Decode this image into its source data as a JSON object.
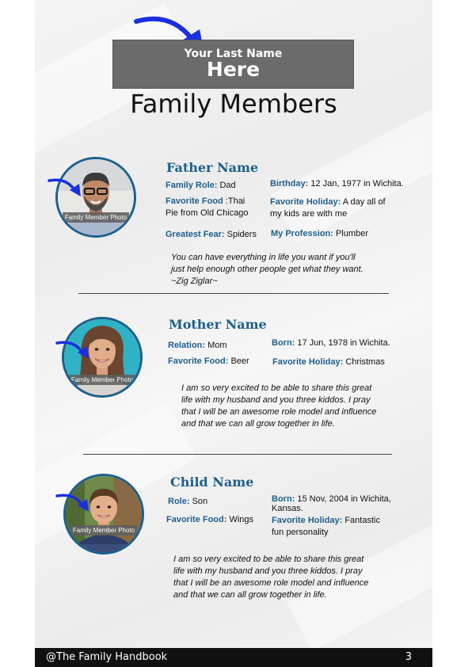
{
  "header": {
    "banner_line1": "Your Last Name",
    "banner_line2": "Here",
    "title": "Family Members"
  },
  "colors": {
    "accent": "#1d5f8c",
    "banner": "#6b6b6b",
    "arrow": "#1a2fe0",
    "footer": "#111111"
  },
  "members": [
    {
      "name": "Father Name",
      "photo_label": "Family Member Photo",
      "fields": [
        {
          "label": "Family Role:",
          "value": "Dad"
        },
        {
          "label": "Birthday:",
          "value": "12 Jan, 1977 in Wichita."
        },
        {
          "label": "Favorite Food",
          "value": ":Thai",
          "extra": "Pie from Old Chicago"
        },
        {
          "label": "Favorite Holiday:",
          "value": "A day all of",
          "extra": "my kids are with me"
        },
        {
          "label": "Greatest Fear:",
          "value": "Spiders"
        },
        {
          "label": "My Profession:",
          "value": "Plumber"
        }
      ],
      "quote": [
        "You can have everything in life you want if you'll",
        "just help enough other people get what they want.",
        "~Zig Ziglar~"
      ]
    },
    {
      "name": "Mother Name",
      "photo_label": "Family Member Photo",
      "fields": [
        {
          "label": "Relation:",
          "value": "Mom"
        },
        {
          "label": "Born:",
          "value": "17 Jun, 1978 in Wichita."
        },
        {
          "label": "Favorite Food:",
          "value": "Beer"
        },
        {
          "label": "Favorite Holiday:",
          "value": "Christmas"
        }
      ],
      "quote": [
        "I am so very excited to be able to share this great",
        "life with my husband and you three kiddos. I pray",
        "that I will be an awesome role model and influence",
        "and that we can all grow together in life."
      ]
    },
    {
      "name": "Child Name",
      "photo_label": "Family Member Photo",
      "fields": [
        {
          "label": "Role:",
          "value": "Son"
        },
        {
          "label": "Born:",
          "value": "15 Nov, 2004 in Wichita,",
          "extra": "Kansas."
        },
        {
          "label": "Favorite Food:",
          "value": "Wings"
        },
        {
          "label": "Favorite Holiday:",
          "value": "Fantastic",
          "extra": "fun personality"
        }
      ],
      "quote": [
        "I am so very excited to be able to share this great",
        "life with my husband and you three kiddos. I pray",
        "that I will be an awesome role model and influence",
        "and that we can all grow together in life."
      ]
    }
  ],
  "footer": {
    "left": "@The Family Handbook",
    "page_number": "3"
  }
}
